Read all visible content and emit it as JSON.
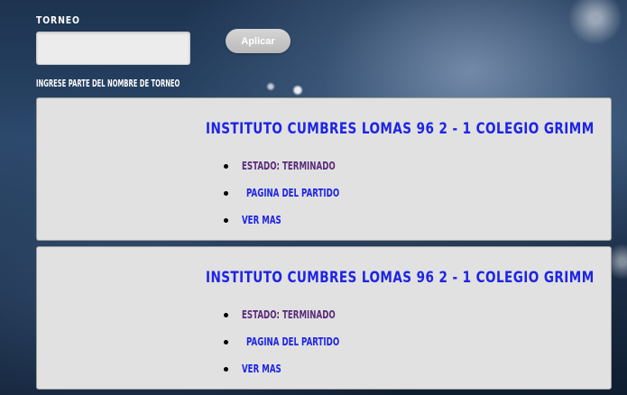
{
  "filter": {
    "label": "TORNEO",
    "input_value": "",
    "input_placeholder": "",
    "apply_label": "Aplicar",
    "hint": "INGRESE PARTE DEL NOMBRE DE TORNEO"
  },
  "matches": [
    {
      "title": "INSTITUTO CUMBRES LOMAS 96 2 - 1 COLEGIO GRIMM",
      "status": "ESTADO: TERMINADO",
      "match_page": "PAGINA DEL PARTIDO",
      "see_more": "VER MAS"
    },
    {
      "title": "INSTITUTO CUMBRES LOMAS 96 2 - 1 COLEGIO GRIMM",
      "status": "ESTADO: TERMINADO",
      "match_page": "PAGINA DEL PARTIDO",
      "see_more": "VER MAS"
    }
  ],
  "colors": {
    "title": "#1d24e6",
    "status": "#5a2a7a",
    "card_bg": "#e1e1e1"
  }
}
